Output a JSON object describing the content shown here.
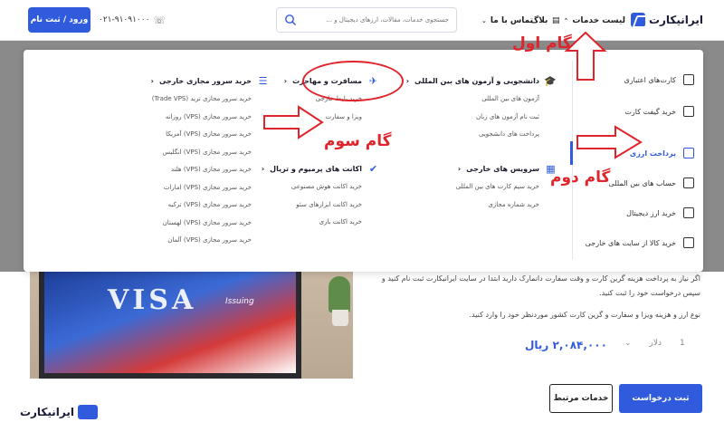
{
  "header": {
    "login_label": "ورود / ثبت نام",
    "phone": "۰۲۱-۹۱۰۹۱۰۰۰",
    "search_placeholder": "جستجوی خدمات، مقالات، ارزهای دیجیتال و ...",
    "nav": {
      "contact": "تماس با ما",
      "blog": "بلاگ",
      "services": "لیست خدمات"
    },
    "logo_text": "ایرانیکارت"
  },
  "sidebar": {
    "items": [
      {
        "label": "کارت‌های اعتباری",
        "icon": "credit-card-icon"
      },
      {
        "label": "خرید گیفت کارت",
        "icon": "gift-icon"
      },
      {
        "label": "پرداخت ارزی",
        "icon": "bank-icon"
      },
      {
        "label": "حساب های بین المللی",
        "icon": "piggy-bank-icon"
      },
      {
        "label": "خرید ارز دیجیتال",
        "icon": "crypto-icon"
      },
      {
        "label": "خرید کالا از سایت های خارجی",
        "icon": "box-icon"
      }
    ]
  },
  "columns": {
    "student": {
      "title": "دانشجویی و آزمون های بین المللی",
      "items": [
        "آزمون های بین المللی",
        "ثبت نام آزمون های زبان",
        "پرداخت های دانشجویی"
      ]
    },
    "foreign": {
      "title": "سرویس های خارجی",
      "items": [
        "خرید سیم کارت های بین المللی",
        "خرید شماره مجازی"
      ]
    },
    "travel": {
      "title": "مسافرت و مهاجرت",
      "items": [
        "خرید بلیط خارجی",
        "ویزا و سفارت"
      ]
    },
    "premium": {
      "title": "اکانت های پرمیوم و تریال",
      "items": [
        "خرید اکانت هوش مصنوعی",
        "خرید اکانت ابزارهای سئو",
        "خرید اکانت بازی"
      ]
    },
    "vps": {
      "title": "خرید سرور مجازی خارجی",
      "items": [
        "خرید سرور مجازی ترید (Trade VPS)",
        "خرید سرور مجازی (VPS) روزانه",
        "خرید سرور مجازی (VPS) آمریکا",
        "خرید سرور مجازی (VPS) انگلیس",
        "خرید سرور مجازی (VPS) هلند",
        "خرید سرور مجازی (VPS) امارات",
        "خرید سرور مجازی (VPS) ترکیه",
        "خرید سرور مجازی (VPS) لهستان",
        "خرید سرور مجازی (VPS) آلمان"
      ]
    }
  },
  "annotations": {
    "step1": "گام اول",
    "step2": "گام دوم",
    "step3": "گام سوم",
    "color": "#e0242b"
  },
  "page": {
    "desc1": "اگر نیاز به پرداخت هزینه گرین کارت و وقت سفارت دانمارک دارید ابتدا در سایت ایرانیکارت ثبت نام کنید و سپس درخواست خود را ثبت کنید.",
    "desc2": "نوع ارز و هزینه ویزا و سفارت و گرین کارت کشور موردنظر خود را وارد کنید.",
    "price": "۲,۰۸۴,۰۰۰ ریال",
    "currency": "دلار",
    "qty": "1",
    "submit_label": "ثبت درخواست",
    "related_label": "خدمات مرتبط",
    "visa_text": "VISA",
    "issuing_text": "Issuing",
    "logo_text": "ایرانیکارت"
  },
  "colors": {
    "primary": "#2f5bdc",
    "annotation": "#e0242b"
  }
}
